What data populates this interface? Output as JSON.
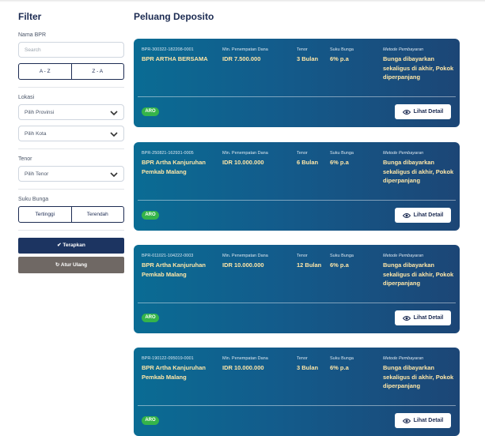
{
  "sidebar": {
    "title": "Filter",
    "bpr_label": "Nama BPR",
    "search_placeholder": "Search",
    "sort_az": "A - Z",
    "sort_za": "Z - A",
    "location_label": "Lokasi",
    "province_select": "Pilih Provinsi",
    "city_select": "Pilih Kota",
    "tenor_label": "Tenor",
    "tenor_select": "Pilih Tenor",
    "rate_label": "Suku Bunga",
    "rate_high": "Tertinggi",
    "rate_low": "Terendah",
    "apply_button": "Terapkan",
    "reset_button": "Atur Ulang",
    "apply_icon": "check-icon",
    "reset_icon": "refresh-icon"
  },
  "main": {
    "title": "Peluang Deposito",
    "headers": {
      "min_deposit": "Min. Penempatan Dana",
      "tenor": "Tenor",
      "rate": "Suku Bunga",
      "payment": "Metode Pembayaran"
    },
    "detail_label": "Lihat Detail",
    "detail_icon": "eye-icon",
    "cards": [
      {
        "code": "BPR-300322-182208-0001",
        "name": "BPR ARTHA BERSAMA",
        "min_deposit": "IDR 7.500.000",
        "tenor": "3 Bulan",
        "rate": "6% p.a",
        "payment": "Bunga dibayarkan sekaligus di akhir, Pokok diperpanjang",
        "badge": "ARO"
      },
      {
        "code": "BPR-250821-162931-0005",
        "name": "BPR Artha Kanjuruhan Pemkab Malang",
        "min_deposit": "IDR 10.000.000",
        "tenor": "6 Bulan",
        "rate": "6% p.a",
        "payment": "Bunga dibayarkan sekaligus di akhir, Pokok diperpanjang",
        "badge": "ARO"
      },
      {
        "code": "BPR-011021-104222-0003",
        "name": "BPR Artha Kanjuruhan Pemkab Malang",
        "min_deposit": "IDR 10.000.000",
        "tenor": "12 Bulan",
        "rate": "6% p.a",
        "payment": "Bunga dibayarkan sekaligus di akhir, Pokok diperpanjang",
        "badge": "ARO"
      },
      {
        "code": "BPR-190122-095019-0001",
        "name": "BPR Artha Kanjuruhan Pemkab Malang",
        "min_deposit": "IDR 10.000.000",
        "tenor": "3 Bulan",
        "rate": "6% p.a",
        "payment": "Bunga dibayarkan sekaligus di akhir, Pokok diperpanjang",
        "badge": "ARO"
      }
    ]
  },
  "colors": {
    "navy": "#1c2b52",
    "card_start": "#0a6c94",
    "card_end": "#1c4676",
    "badge_green": "#35b44a",
    "highlight_text": "#ffe7a8",
    "reset_button": "#6f6864"
  }
}
